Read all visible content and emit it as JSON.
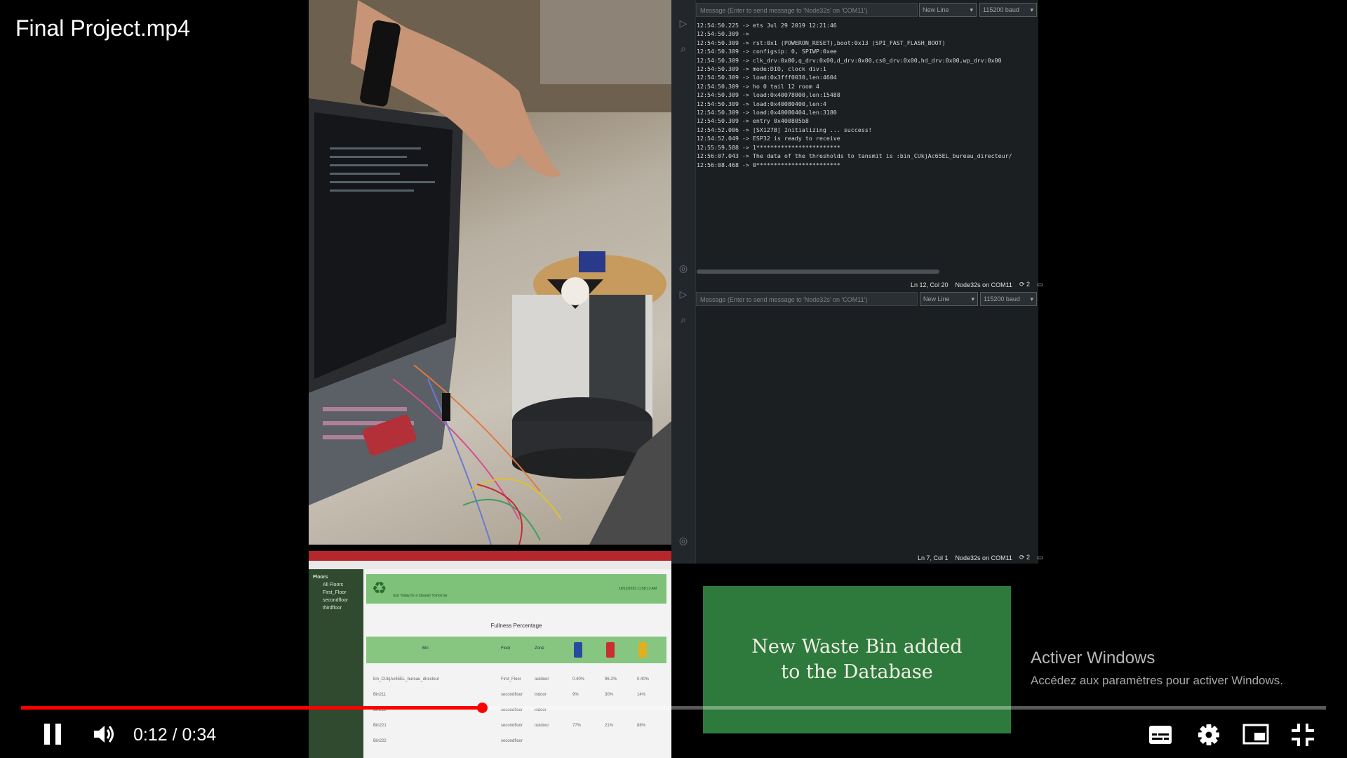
{
  "video": {
    "title": "Final Project.mp4",
    "current_time": "0:12",
    "duration": "0:34",
    "time_separator": " / ",
    "progress_fraction": 0.353
  },
  "serial_monitor_top": {
    "message_placeholder": "Message (Enter to send message to 'Node32s' on 'COM11')",
    "line_ending": "New Line",
    "baud": "115200 baud",
    "log": [
      "12:54:50.225 -> ets Jul 29 2019 12:21:46",
      "12:54:50.309 ->",
      "12:54:50.309 -> rst:0x1 (POWERON_RESET),boot:0x13 (SPI_FAST_FLASH_BOOT)",
      "12:54:50.309 -> configsip: 0, SPIWP:0xee",
      "12:54:50.309 -> clk_drv:0x00,q_drv:0x00,d_drv:0x00,cs0_drv:0x00,hd_drv:0x00,wp_drv:0x00",
      "12:54:50.309 -> mode:DIO, clock div:1",
      "12:54:50.309 -> load:0x3fff0030,len:4604",
      "12:54:50.309 -> ho 0 tail 12 room 4",
      "12:54:50.309 -> load:0x40078000,len:15488",
      "12:54:50.309 -> load:0x40080400,len:4",
      "12:54:50.309 -> load:0x40080404,len:3180",
      "12:54:50.309 -> entry 0x400805b8",
      "12:54:52.006 -> [SX1278] Initializing ... success!",
      "12:54:52.049 -> ESP32 is ready to receive",
      "12:55:59.588 -> 1************************",
      "12:56:07.043 -> The data of the thresholds to tansmit is :bin_CUkjAc65EL_bureau_directeur/",
      "12:56:08.468 -> 0************************"
    ],
    "status_position": "Ln 12, Col 20",
    "status_board": "Node32s on COM11",
    "status_count": "2"
  },
  "serial_monitor_bottom": {
    "message_placeholder": "Message (Enter to send message to 'Node32s' on 'COM11')",
    "line_ending": "New Line",
    "baud": "115200 baud",
    "status_position": "Ln 7, Col 1",
    "status_board": "Node32s on COM11",
    "status_count": "2"
  },
  "dashboard": {
    "sidebar_title": "Floors",
    "sidebar_items": [
      "All Floors",
      "First_Floor",
      "secondfloor",
      "thirdfloor"
    ],
    "header_tagline": "Sort Today for a Cleaner Tomorrow",
    "header_date": "18/12/2023 11:58:13 AM",
    "section_title": "Fullness Percentage",
    "columns": [
      "Bin",
      "Floor",
      "Zone"
    ],
    "rows": [
      [
        "bin_CUkjAc65EL_bureau_directeur",
        "First_Floor",
        "outdoor",
        "0.40%",
        "96.2%",
        "0.40%"
      ],
      [
        "Bin211",
        "secondfloor",
        "indoor",
        "9%",
        "30%",
        "14%"
      ],
      [
        "Bin212",
        "secondfloor",
        "indoor",
        "",
        "",
        ""
      ],
      [
        "Bin221",
        "secondfloor",
        "outdoor",
        "77%",
        "21%",
        "88%"
      ],
      [
        "Bin222",
        "secondfloor",
        "",
        "",
        "",
        ""
      ]
    ]
  },
  "banner": {
    "line1": "New Waste Bin added",
    "line2": "to the Database"
  },
  "watermark": {
    "title": "Activer Windows",
    "subtitle": "Accédez aux paramètres pour activer Windows."
  },
  "controls": {
    "play_state_icon": "pause-icon",
    "volume_icon": "volume-icon",
    "subtitles_icon": "subtitles-icon",
    "settings_icon": "settings-gear-icon",
    "miniplayer_icon": "miniplayer-icon",
    "fullscreen_icon": "exit-fullscreen-icon"
  },
  "colors": {
    "progress": "#ff0000",
    "banner_green": "#2e7a3c",
    "dashboard_red": "#b5262d",
    "dashboard_green": "#7ec27a",
    "monitor_bg": "#1b1f22"
  }
}
